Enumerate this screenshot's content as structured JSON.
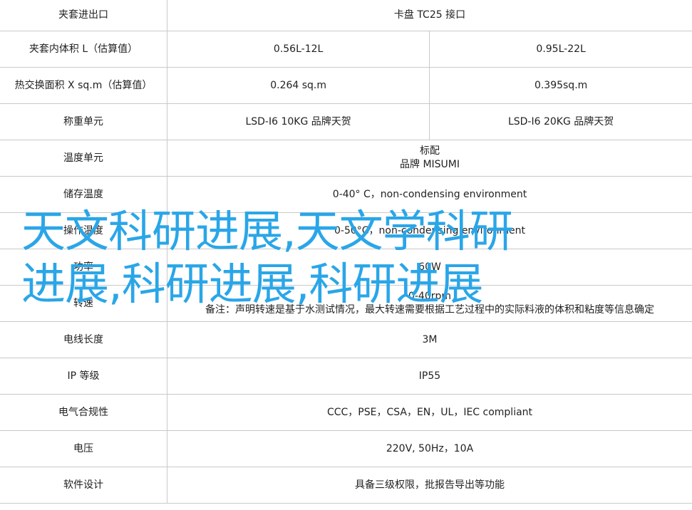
{
  "rows": [
    {
      "label": "夹套进出口",
      "values": [
        "卡盘 TC25 接口"
      ]
    },
    {
      "label": "夹套内体积 L（估算值）",
      "values": [
        "0.56L-12L",
        "0.95L-22L"
      ]
    },
    {
      "label": "热交换面积 X sq.m（估算值）",
      "values": [
        "0.264 sq.m",
        "0.395sq.m"
      ]
    },
    {
      "label": "称重单元",
      "values": [
        "LSD-I6 10KG 品牌天贺",
        "LSD-I6 20KG 品牌天贺"
      ]
    },
    {
      "label": "温度单元",
      "lines": [
        "标配",
        "品牌 MISUMI"
      ]
    },
    {
      "label": "储存温度",
      "values": [
        "0-40° C，non-condensing environment"
      ]
    },
    {
      "label": "操作温度",
      "values": [
        "0-50°C，non-condensing environment"
      ]
    },
    {
      "label": "功率",
      "values": [
        "60W"
      ]
    },
    {
      "label": "转速",
      "lines": [
        "0-40rpm",
        "备注：声明转速是基于水测试情况，最大转速需要根据工艺过程中的实际料液的体积和粘度等信息确定"
      ]
    },
    {
      "label": "电线长度",
      "values": [
        "3M"
      ]
    },
    {
      "label": "IP 等级",
      "values": [
        "IP55"
      ]
    },
    {
      "label": "电气合规性",
      "values": [
        "CCC，PSE，CSA，EN，UL，IEC compliant"
      ]
    },
    {
      "label": "电压",
      "values": [
        "220V, 50Hz，10A"
      ]
    },
    {
      "label": "软件设计",
      "values": [
        "具备三级权限，批报告导出等功能"
      ]
    }
  ],
  "overlay": {
    "line1": "天文科研进展,天文学科研",
    "line2": "进展,科研进展,科研进展",
    "color": "#2aa6e8"
  }
}
